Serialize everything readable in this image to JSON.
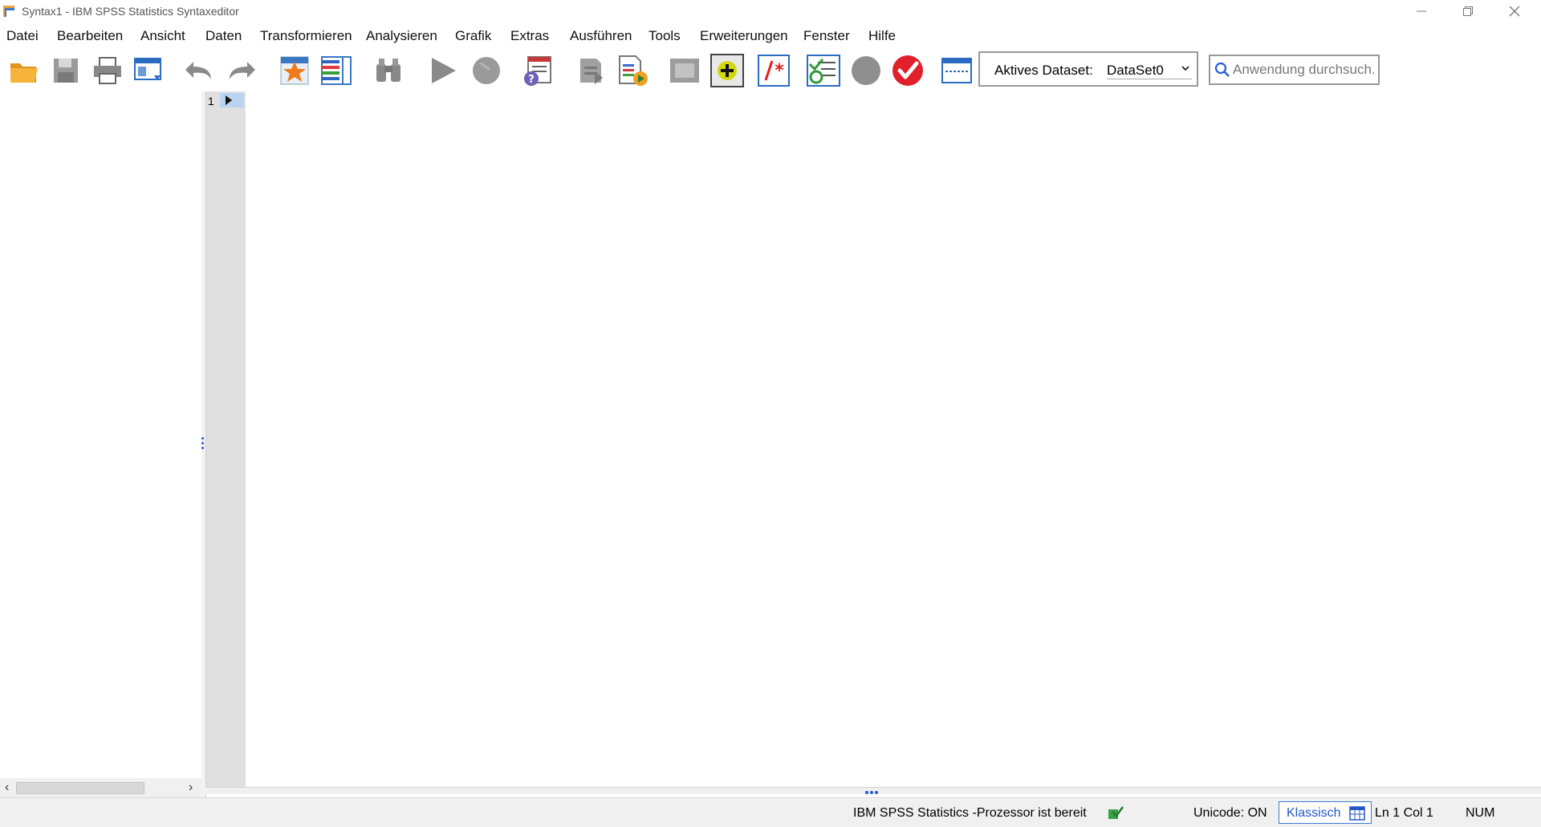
{
  "window": {
    "title": "Syntax1 - IBM SPSS Statistics Syntaxeditor"
  },
  "menu": {
    "items": [
      {
        "label": "Datei"
      },
      {
        "label": "Bearbeiten"
      },
      {
        "label": "Ansicht"
      },
      {
        "label": "Daten"
      },
      {
        "label": "Transformieren"
      },
      {
        "label": "Analysieren"
      },
      {
        "label": "Grafik"
      },
      {
        "label": "Extras"
      },
      {
        "label": "Ausführen"
      },
      {
        "label": "Tools"
      },
      {
        "label": "Erweiterungen"
      },
      {
        "label": "Fenster"
      },
      {
        "label": "Hilfe"
      }
    ]
  },
  "toolbar": {
    "icons": [
      "open-folder-icon",
      "save-icon",
      "print-icon",
      "dialog-recall-icon",
      "undo-icon",
      "redo-icon",
      "goto-case-icon",
      "variables-icon",
      "find-icon",
      "run-selection-icon",
      "stop-icon",
      "syntax-help-icon",
      "goto-bookmark-icon",
      "run-to-end-icon",
      "toggle-bookmark-icon",
      "add-breakpoint-icon",
      "comment-selection-icon",
      "validate-icon",
      "record-icon",
      "check-icon",
      "split-view-icon"
    ],
    "dataset_label": "Aktives Dataset:",
    "dataset_value": "DataSet0"
  },
  "search": {
    "placeholder": "Anwendung durchsuch..."
  },
  "editor": {
    "line_number": "1"
  },
  "status": {
    "processor": "IBM SPSS Statistics -Prozessor ist bereit",
    "unicode": "Unicode: ON",
    "mode": "Klassisch",
    "position": "Ln 1 Col 1",
    "num": "NUM"
  },
  "colors": {
    "accent": "#2458c8",
    "gutter": "#e0e0e0",
    "current_line": "#b9d4f2"
  }
}
